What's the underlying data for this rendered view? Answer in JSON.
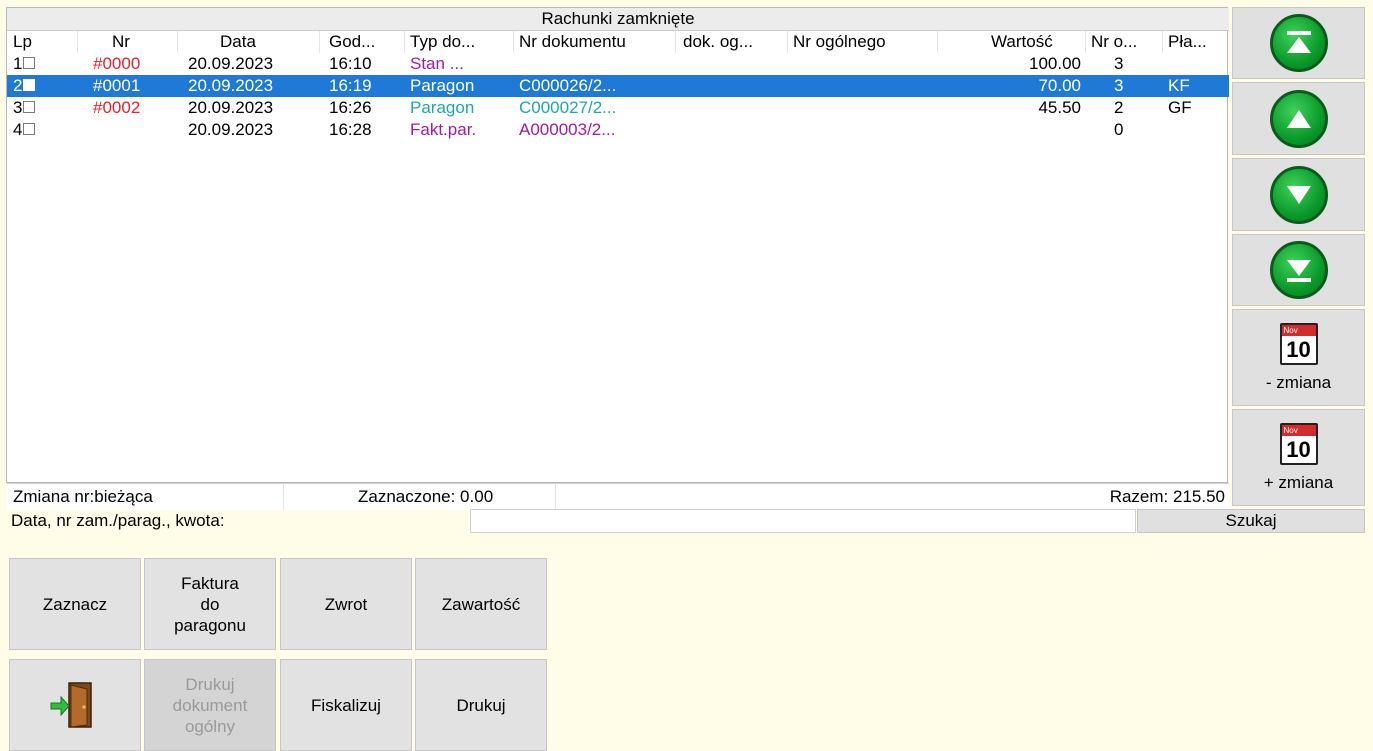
{
  "grid": {
    "title": "Rachunki zamknięte",
    "headers": [
      "Lp",
      "Nr",
      "Data",
      "God...",
      "Typ do...",
      "Nr dokumentu",
      "dok. og...",
      "Nr ogólnego",
      "Wartość",
      "Nr o...",
      "Pła..."
    ],
    "rows": [
      {
        "lp": "1",
        "nr": "#0000",
        "data": "20.09.2023",
        "godz": "16:10",
        "typ": "Stan ...",
        "nrdok": "",
        "wartosc": "100.00",
        "nro": "3",
        "pla": "",
        "selected": false,
        "typ_color": "purple"
      },
      {
        "lp": "2",
        "nr": "#0001",
        "data": "20.09.2023",
        "godz": "16:19",
        "typ": "Paragon",
        "nrdok": "C000026/2...",
        "wartosc": "70.00",
        "nro": "3",
        "pla": "KF",
        "selected": true,
        "typ_color": "teal"
      },
      {
        "lp": "3",
        "nr": "#0002",
        "data": "20.09.2023",
        "godz": "16:26",
        "typ": "Paragon",
        "nrdok": "C000027/2...",
        "wartosc": "45.50",
        "nro": "2",
        "pla": "GF",
        "selected": false,
        "typ_color": "teal"
      },
      {
        "lp": "4",
        "nr": "",
        "data": "20.09.2023",
        "godz": "16:28",
        "typ": "Fakt.par.",
        "nrdok": "A000003/2...",
        "wartosc": "",
        "nro": "0",
        "pla": "",
        "selected": false,
        "typ_color": "purple"
      }
    ],
    "footer": {
      "zmiana": "Zmiana nr:bieżąca",
      "zaznaczone": "Zaznaczone: 0.00",
      "razem": "Razem: 215.50"
    }
  },
  "side": {
    "cal_month": "Nov",
    "cal_day": "10",
    "prev_shift_label": "- zmiana",
    "next_shift_label": "+ zmiana"
  },
  "search": {
    "label": "Data, nr zam./parag., kwota:",
    "value": "",
    "button": "Szukaj"
  },
  "buttons": {
    "zaznacz": "Zaznacz",
    "faktura": "Faktura\ndo\nparagonu",
    "zwrot": "Zwrot",
    "zawartosc": "Zawartość",
    "drukuj_ogolny": "Drukuj\ndokument\nogólny",
    "fiskalizuj": "Fiskalizuj",
    "drukuj": "Drukuj"
  },
  "colors": {
    "selection": "#1e7ad6",
    "nr": "#e8222a",
    "purple": "#a31aa3",
    "teal": "#1ea8a8",
    "arrow_green": "#0a9a2a"
  },
  "icons": [
    "arrow-top-icon",
    "arrow-up-icon",
    "arrow-down-icon",
    "arrow-bottom-icon",
    "calendar-icon",
    "exit-door-icon"
  ]
}
